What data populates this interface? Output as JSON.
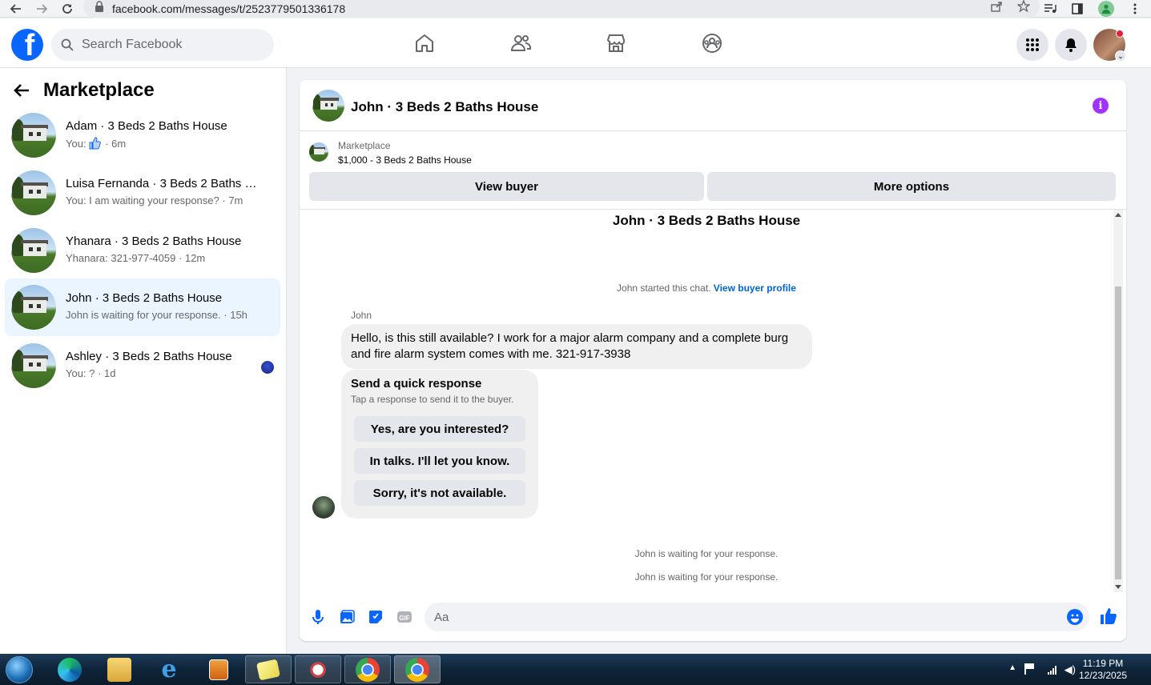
{
  "browser": {
    "url": "facebook.com/messages/t/2523779501336178"
  },
  "header": {
    "search_placeholder": "Search Facebook"
  },
  "sidebar": {
    "title": "Marketplace",
    "conversations": [
      {
        "name": "Adam · 3 Beds 2 Baths House",
        "preview_prefix": "You:",
        "preview": "",
        "time": "6m",
        "has_like": true
      },
      {
        "name": "Luisa Fernanda · 3 Beds 2 Baths H...",
        "preview": "You: I am waiting your response?",
        "time": "7m"
      },
      {
        "name": "Yhanara · 3 Beds 2 Baths House",
        "preview": "Yhanara: 321-977-4059",
        "time": "12m"
      },
      {
        "name": "John · 3 Beds 2 Baths House",
        "preview": "John is waiting for your response.",
        "time": "15h",
        "active": true
      },
      {
        "name": "Ashley · 3 Beds 2 Baths House",
        "preview": "You: ?",
        "time": "1d",
        "unread": true
      }
    ]
  },
  "chat": {
    "title": "John · 3 Beds 2 Baths House",
    "listing_category": "Marketplace",
    "listing_price": "$1,000 - 3 Beds 2 Baths House",
    "view_buyer_label": "View buyer",
    "more_options_label": "More options",
    "thread_title": "John · 3 Beds 2 Baths House",
    "started_text": "John started this chat.",
    "view_profile_link": "View buyer profile",
    "sender_name": "John",
    "message": "Hello, is this still available? I work for a major alarm company and a complete burg and fire alarm system comes with me. 321-917-3938",
    "quick_response": {
      "heading": "Send a quick response",
      "subtext": "Tap a response to send it to the buyer.",
      "options": [
        "Yes, are you interested?",
        "In talks. I'll let you know.",
        "Sorry, it's not available."
      ]
    },
    "waiting_1": "John is waiting for your response.",
    "waiting_2": "John is waiting for your response.",
    "composer_placeholder": "Aa"
  },
  "taskbar": {
    "time": "11:19 PM",
    "date": "12/23/2025"
  },
  "colors": {
    "brand": "#0866ff",
    "active_row": "#ebf5ff",
    "info_purple": "#a033ff",
    "link": "#0064d1"
  }
}
